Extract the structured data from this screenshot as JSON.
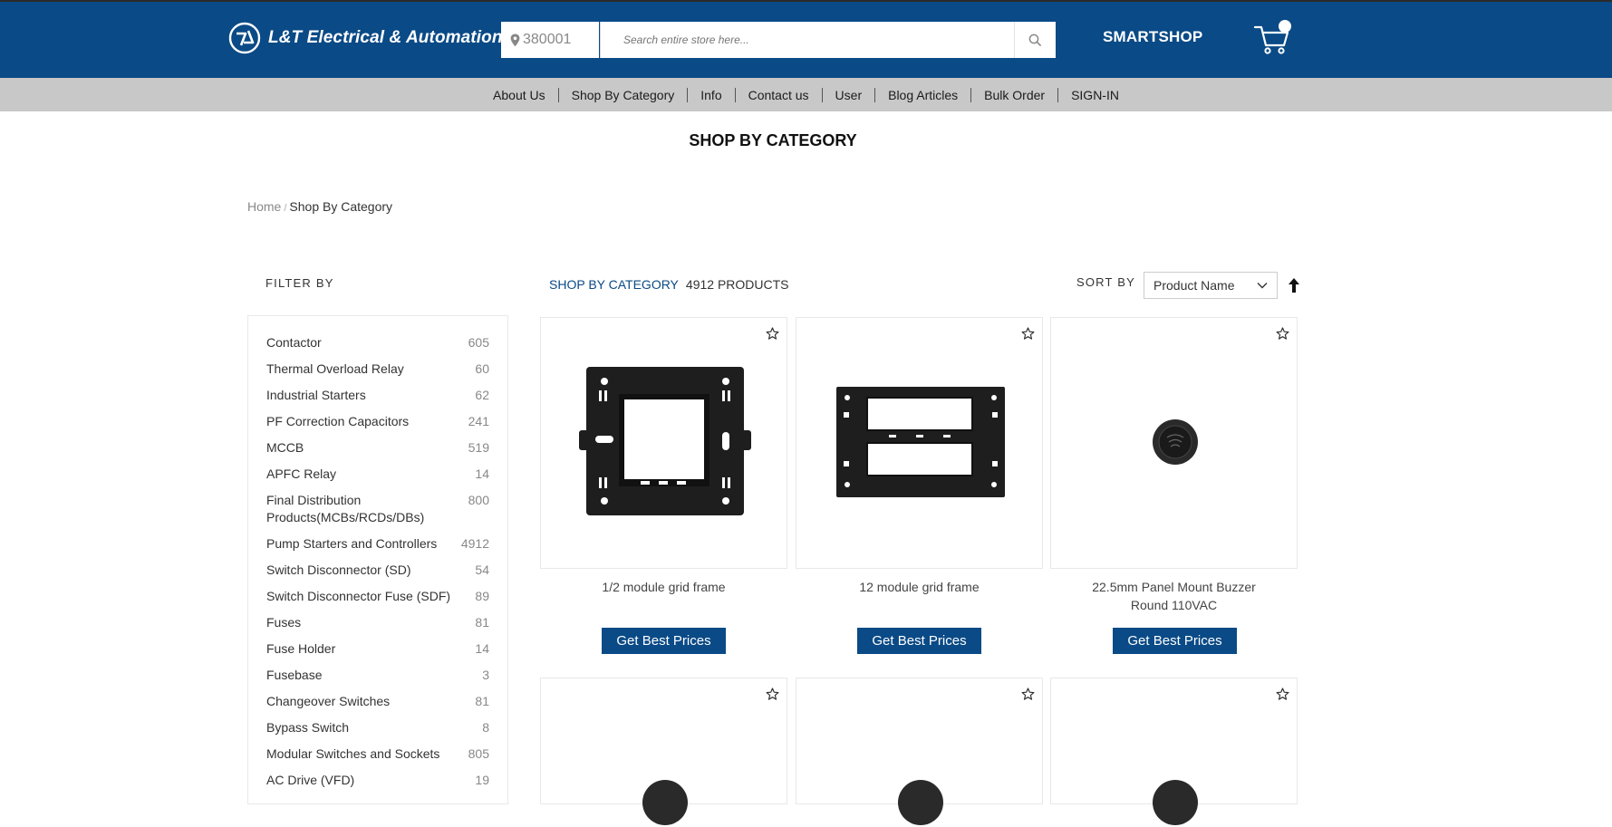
{
  "header": {
    "brand": "L&T Electrical & Automation",
    "pincode": "380001",
    "search_placeholder": "Search entire store here...",
    "smartshop": "SMARTSHOP"
  },
  "nav": [
    "About Us",
    "Shop By Category",
    "Info",
    "Contact us",
    "User",
    "Blog Articles",
    "Bulk Order",
    "SIGN-IN"
  ],
  "page_title": "SHOP BY CATEGORY",
  "breadcrumb": {
    "home": "Home",
    "sep": "/",
    "current": "Shop By Category"
  },
  "filter": {
    "title": "FILTER BY",
    "items": [
      {
        "name": "Contactor",
        "count": "605"
      },
      {
        "name": "Thermal Overload Relay",
        "count": "60"
      },
      {
        "name": "Industrial Starters",
        "count": "62"
      },
      {
        "name": "PF Correction Capacitors",
        "count": "241"
      },
      {
        "name": "MCCB",
        "count": "519"
      },
      {
        "name": "APFC Relay",
        "count": "14"
      },
      {
        "name": "Final Distribution Products(MCBs/RCDs/DBs)",
        "count": "800"
      },
      {
        "name": "Pump Starters and Controllers",
        "count": "4912"
      },
      {
        "name": "Switch Disconnector (SD)",
        "count": "54"
      },
      {
        "name": "Switch Disconnector Fuse (SDF)",
        "count": "89"
      },
      {
        "name": "Fuses",
        "count": "81"
      },
      {
        "name": "Fuse Holder",
        "count": "14"
      },
      {
        "name": "Fusebase",
        "count": "3"
      },
      {
        "name": "Changeover Switches",
        "count": "81"
      },
      {
        "name": "Bypass Switch",
        "count": "8"
      },
      {
        "name": "Modular Switches and Sockets",
        "count": "805"
      },
      {
        "name": "AC Drive (VFD)",
        "count": "19"
      }
    ]
  },
  "listing": {
    "label": "SHOP BY CATEGORY",
    "count": "4912 PRODUCTS",
    "sort_label": "SORT BY",
    "sort_value": "Product Name"
  },
  "products": [
    {
      "title": "1/2 module grid frame",
      "button": "Get Best Prices"
    },
    {
      "title": "12 module grid frame",
      "button": "Get Best Prices"
    },
    {
      "title": "22.5mm Panel Mount Buzzer Round 110VAC",
      "button": "Get Best Prices"
    }
  ],
  "colors": {
    "brand_blue": "#0a4a86",
    "nav_gray": "#c8c8c8"
  }
}
